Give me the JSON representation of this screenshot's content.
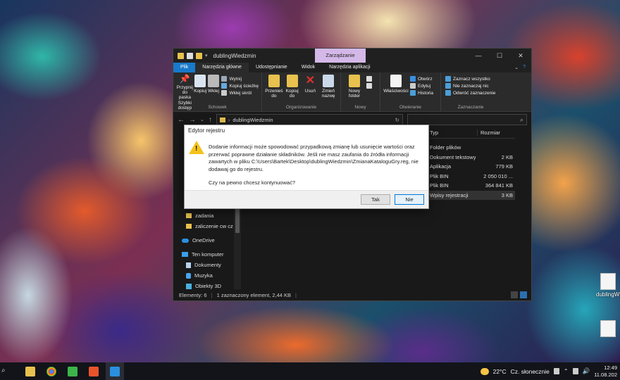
{
  "explorer": {
    "title": "dublingWiedzmin",
    "context_tab": "Zarządzanie",
    "window_buttons": [
      "—",
      "☐",
      "✕"
    ],
    "ribbon_tabs": [
      "Plik",
      "Narzędzia główne",
      "Udostępnianie",
      "Widok",
      "Narzędzia aplikacji"
    ],
    "ribbon": {
      "schowek": {
        "label": "Schowek",
        "pin": "Przypnij do paska Szybki dostęp",
        "copy": "Kopiuj",
        "paste": "Wklej",
        "cut": "Wytnij",
        "copy_path": "Kopiuj ścieżkę",
        "paste_shortcut": "Wklej skrót"
      },
      "organizowanie": {
        "label": "Organizowanie",
        "move": "Przenieś do",
        "copy_to": "Kopiuj do",
        "delete": "Usuń",
        "rename": "Zmień nazwę"
      },
      "nowy": {
        "label": "Nowy",
        "new_folder": "Nowy folder"
      },
      "otwieranie": {
        "label": "Otwieranie",
        "properties": "Właściwości",
        "open": "Otwórz",
        "edit": "Edytuj",
        "history": "Historia"
      },
      "zaznaczanie": {
        "label": "Zaznaczanie",
        "select_all": "Zaznacz wszystko",
        "select_none": "Nie zaznaczaj nic",
        "invert": "Odwróć zaznaczenie"
      }
    },
    "address": {
      "path": "dublingWiedzmin"
    },
    "sidebar": [
      {
        "label": "zadania",
        "icon": "folder"
      },
      {
        "label": "zaliczenie cw cz",
        "icon": "folder"
      },
      {
        "label": "OneDrive",
        "icon": "cloud"
      },
      {
        "label": "Ten komputer",
        "icon": "pc"
      },
      {
        "label": "Dokumenty",
        "icon": "doc"
      },
      {
        "label": "Muzyka",
        "icon": "music"
      },
      {
        "label": "Obiekty 3D",
        "icon": "cube"
      }
    ],
    "columns": {
      "type": "Typ",
      "size": "Rozmiar"
    },
    "files": [
      {
        "type": "Folder plików",
        "size": ""
      },
      {
        "type": "Dokument tekstowy",
        "size": "2 KB"
      },
      {
        "type": "Aplikacja",
        "size": "779 KB"
      },
      {
        "type": "Plik BIN",
        "size": "2 050 010 ..."
      },
      {
        "type": "Plik BIN",
        "size": "364 841 KB"
      },
      {
        "type": "Wpisy rejestracji",
        "size": "3 KB"
      }
    ],
    "status": {
      "elements": "Elementy: 6",
      "selected": "1 zaznaczony element, 2,44 KB"
    }
  },
  "dialog": {
    "title": "Edytor rejestru",
    "message": "Dodanie informacji może spowodować przypadkową zmianę lub usunięcie wartości oraz przerwać poprawne działanie składników. Jeśli nie masz zaufania do źródła informacji zawartych w pliku C:\\Users\\Bartek\\Desktop\\dublingWiedzmin\\ZmianaKataloguGry.reg, nie dodawaj go do rejestru.",
    "question": "Czy na pewno chcesz kontynuować?",
    "yes": "Tak",
    "no": "Nie"
  },
  "desktop": {
    "icon_label": "dublingWi"
  },
  "taskbar": {
    "weather_temp": "22°C",
    "weather_text": "Cz. słonecznie",
    "time": "12:49",
    "date": "11.08.202"
  }
}
